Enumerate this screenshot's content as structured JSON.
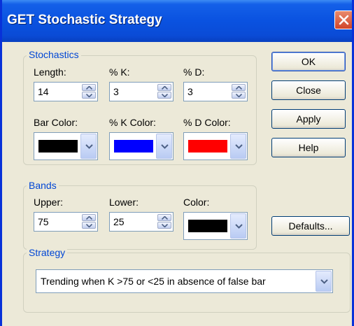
{
  "window": {
    "title": "GET Stochastic Strategy"
  },
  "stochastics": {
    "legend": "Stochastics",
    "length_label": "Length:",
    "length_value": "14",
    "k_label": "% K:",
    "k_value": "3",
    "d_label": "% D:",
    "d_value": "3",
    "bar_color_label": "Bar Color:",
    "bar_color": "#000000",
    "k_color_label": "% K Color:",
    "k_color": "#0000ff",
    "d_color_label": "% D Color:",
    "d_color": "#ff0000"
  },
  "bands": {
    "legend": "Bands",
    "upper_label": "Upper:",
    "upper_value": "75",
    "lower_label": "Lower:",
    "lower_value": "25",
    "color_label": "Color:",
    "color": "#000000"
  },
  "strategy": {
    "legend": "Strategy",
    "selected": "Trending when K >75 or <25 in absence of false bar"
  },
  "buttons": {
    "ok": "OK",
    "close": "Close",
    "apply": "Apply",
    "help": "Help",
    "defaults": "Defaults..."
  },
  "icons": {
    "close": "close-icon",
    "spin_up": "spin-up-arrow-icon",
    "spin_down": "spin-down-arrow-icon",
    "dropdown": "chevron-down-icon"
  }
}
